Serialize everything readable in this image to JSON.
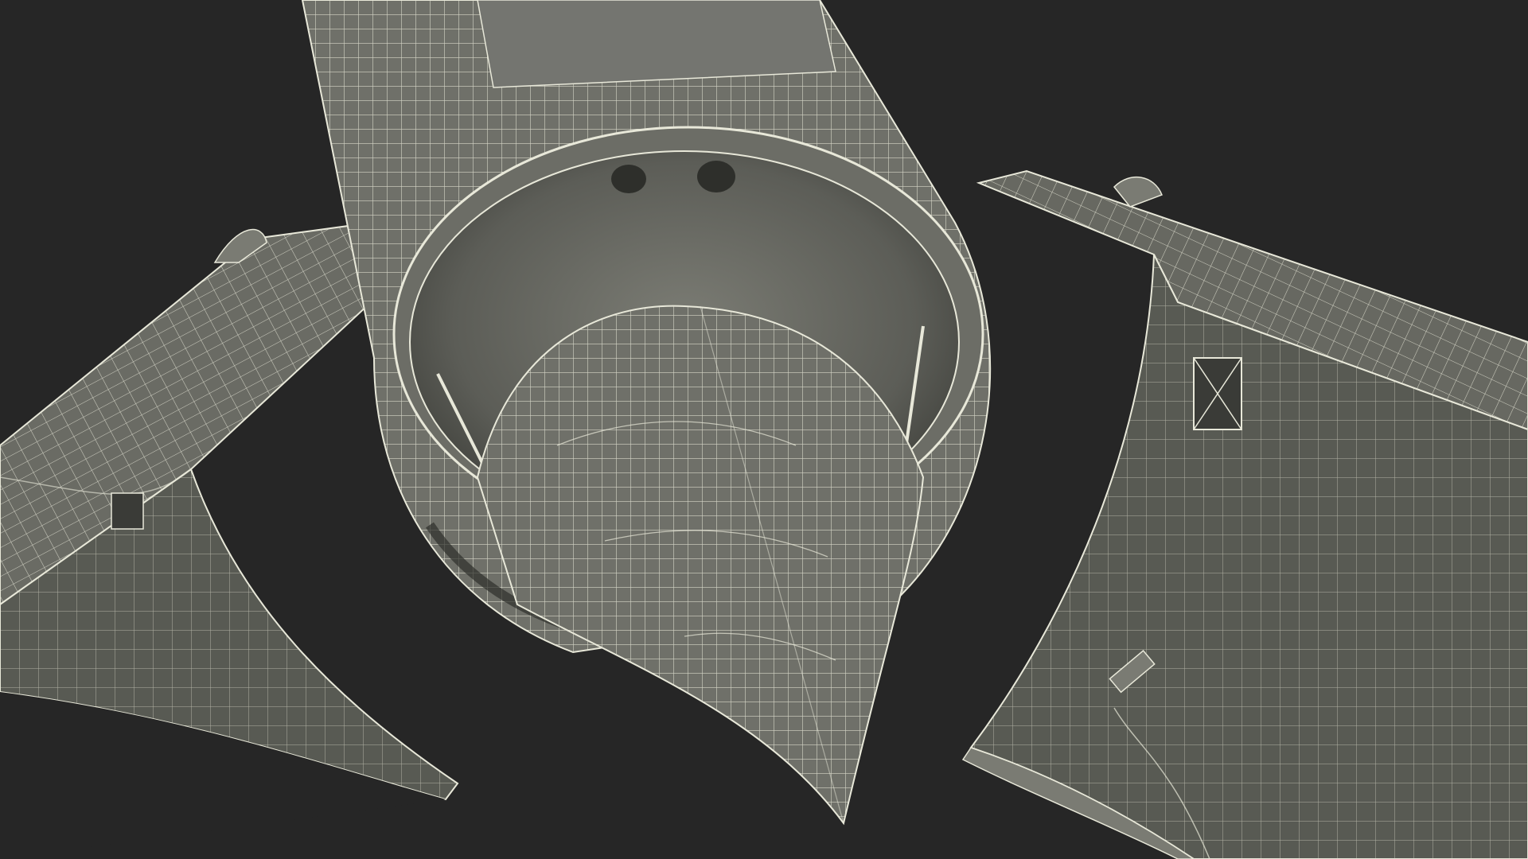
{
  "image": {
    "subject": "wireframe-render",
    "parts": [
      {
        "name": "main-cylinder-body"
      },
      {
        "name": "nose-cone"
      },
      {
        "name": "left-fairing-panel"
      },
      {
        "name": "right-fairing-panel"
      }
    ]
  },
  "colors": {
    "background": "#262626",
    "mesh_fill": "#6f7069",
    "mesh_fill_dark": "#585a53",
    "wire": "#e8e8d9",
    "shadow": "#3a3b37"
  }
}
